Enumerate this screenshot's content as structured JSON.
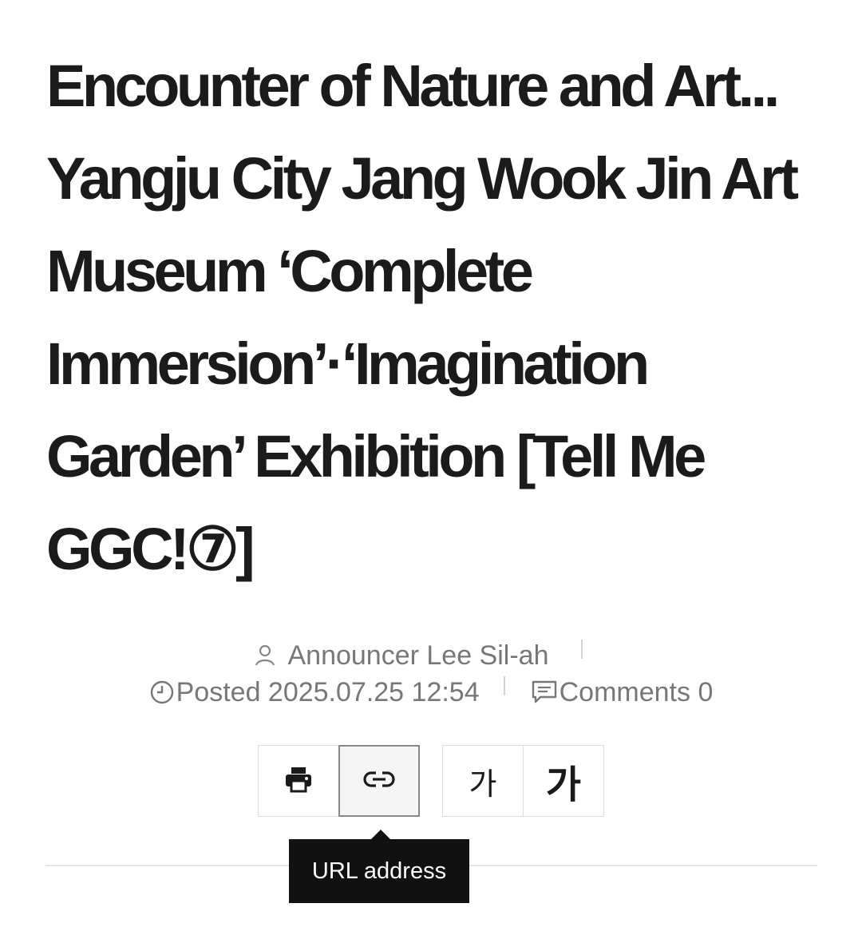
{
  "article": {
    "title": "Encounter of Nature and Art... Yangju City Jang Wook Jin Art Museum ‘Complete Immersion’·‘Imagination Garden’ Exhibition [Tell Me GGC!⑦]"
  },
  "meta": {
    "author": "Announcer Lee Sil-ah",
    "posted": "Posted 2025.07.25 12:54",
    "comments": "Comments 0"
  },
  "toolbar": {
    "print_icon": "print-icon",
    "link_icon": "link-icon",
    "font_small_label": "가",
    "font_large_label": "가"
  },
  "tooltip": {
    "text": "URL address"
  },
  "colors": {
    "title": "#1b1b1b",
    "meta_text": "#777777",
    "tooltip_bg": "#111111",
    "border": "#dddddd"
  }
}
